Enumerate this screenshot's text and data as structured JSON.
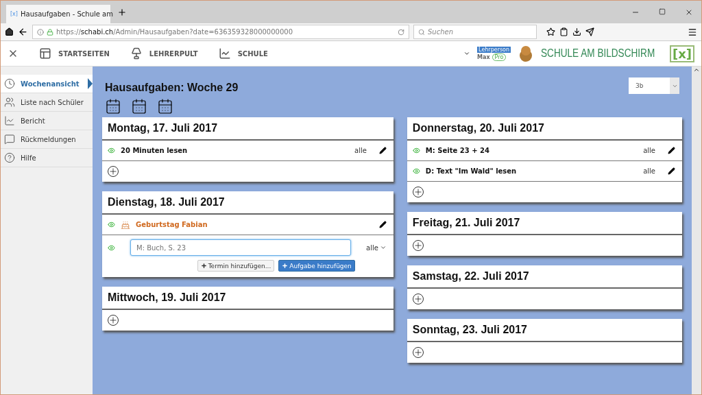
{
  "browser": {
    "tab_icon": "[x]",
    "tab_title": "Hausaufgaben - Schule am ",
    "url_prefix": "https://",
    "url_host": "schabi.ch",
    "url_path": "/Admin/Hausaufgaben?date=636359328000000000",
    "search_placeholder": "Suchen"
  },
  "app_nav": [
    "STARTSEITEN",
    "LEHRERPULT",
    "SCHULE"
  ],
  "user": {
    "role": "Lehrperson",
    "name": "Max",
    "plan": "Pro"
  },
  "logo": {
    "text": "SCHULE AM BILDSCHIRM",
    "mark": "[x]"
  },
  "sidebar": {
    "items": [
      {
        "label": "Wochenansicht",
        "selected": true
      },
      {
        "label": "Liste nach Schüler",
        "selected": false
      },
      {
        "label": "Bericht",
        "selected": false
      },
      {
        "label": "Rückmeldungen",
        "selected": false
      },
      {
        "label": "Hilfe",
        "selected": false
      }
    ]
  },
  "main": {
    "title": "Hausaufgaben: Woche 29",
    "class_select": "3b",
    "columns": [
      [
        {
          "day": "Montag, 17. Juli 2017",
          "entries": [
            {
              "kind": "task",
              "text": "20 Minuten lesen",
              "audience": "alle",
              "visible": true
            }
          ]
        },
        {
          "day": "Dienstag, 18. Juli 2017",
          "entries": [
            {
              "kind": "event",
              "text": "Geburtstag Fabian",
              "visible": true
            },
            {
              "kind": "editor",
              "placeholder": "M: Buch, S. 23",
              "audience": "alle",
              "visible": true,
              "buttons": [
                {
                  "label": "Termin hinzufügen...",
                  "primary": false
                },
                {
                  "label": "Aufgabe hinzufügen",
                  "primary": true
                }
              ]
            }
          ]
        },
        {
          "day": "Mittwoch, 19. Juli 2017"
        }
      ],
      [
        {
          "day": "Donnerstag, 20. Juli 2017",
          "entries": [
            {
              "kind": "task",
              "text": "M: Seite 23 + 24",
              "audience": "alle",
              "visible": true
            },
            {
              "kind": "task",
              "text": "D: Text \"Im Wald\" lesen",
              "audience": "alle",
              "visible": true
            }
          ]
        },
        {
          "day": "Freitag, 21. Juli 2017"
        },
        {
          "day": "Samstag, 22. Juli 2017"
        },
        {
          "day": "Sonntag, 23. Juli 2017"
        }
      ]
    ]
  }
}
